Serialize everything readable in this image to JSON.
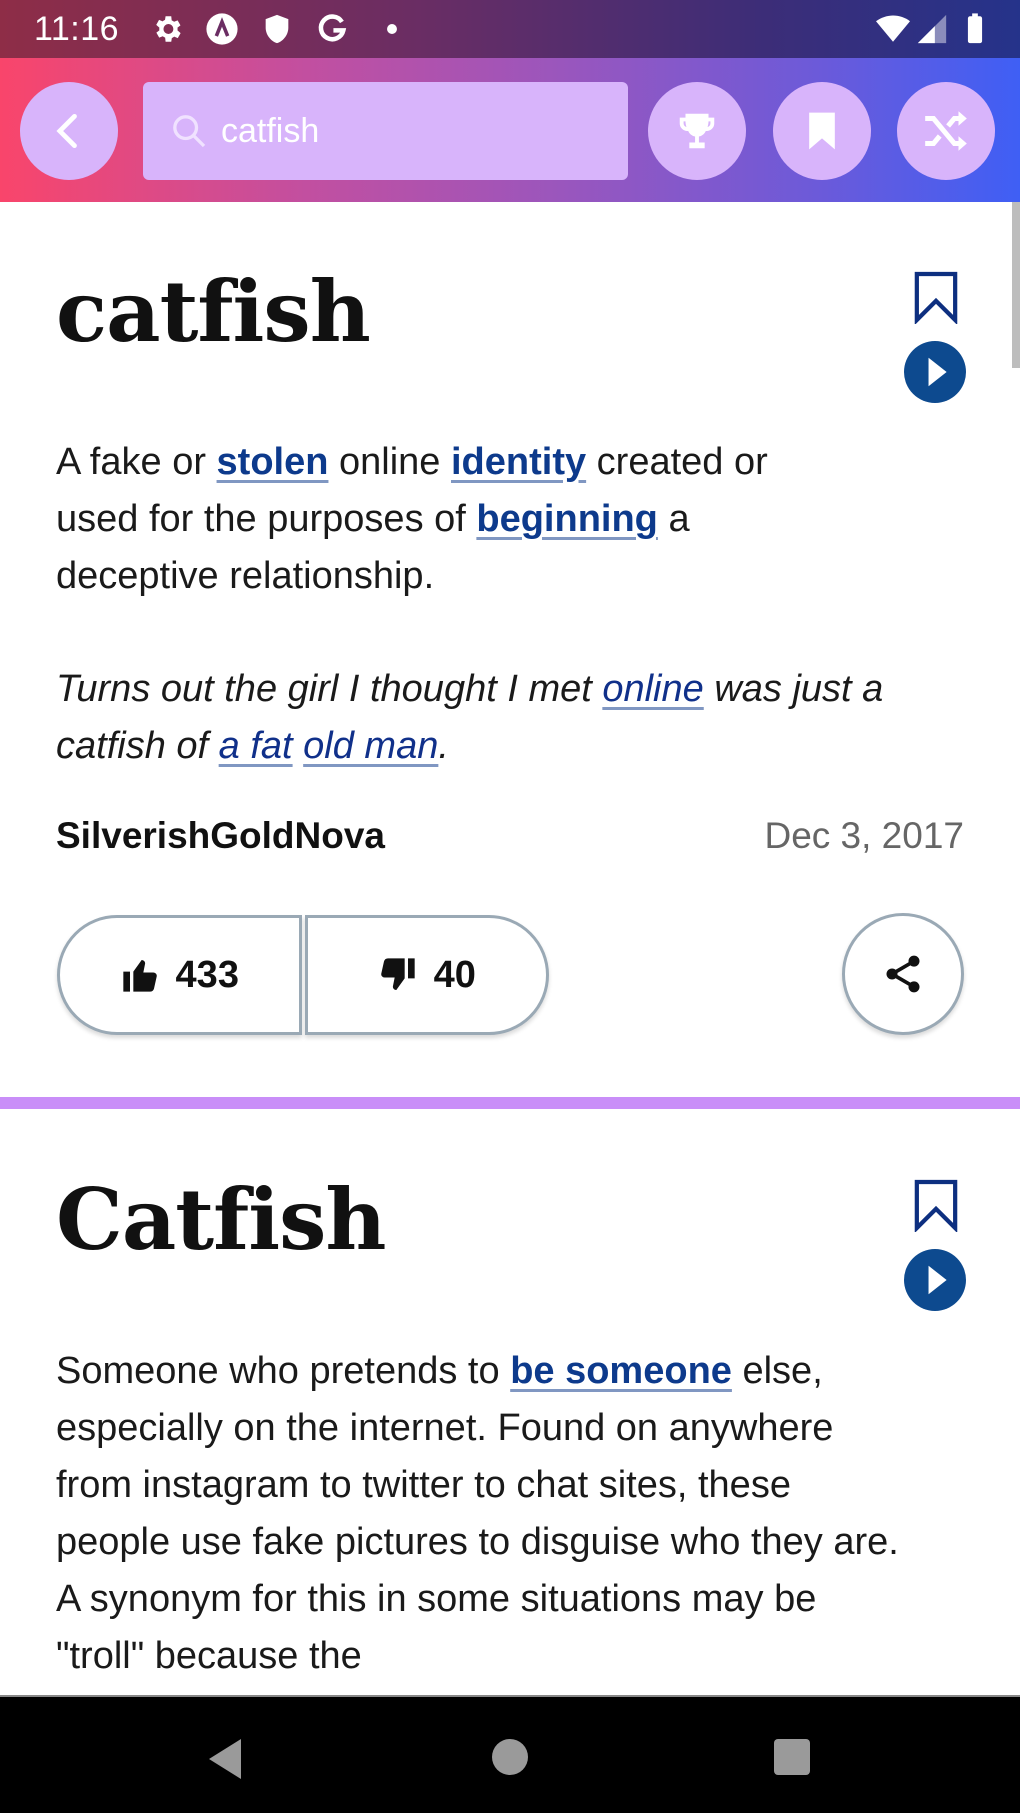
{
  "status_bar": {
    "time": "11:16",
    "left_icons": [
      "settings-icon",
      "app-a-icon",
      "shield-icon",
      "google-icon",
      "dot-icon"
    ],
    "right_icons": [
      "wifi-icon",
      "signal-icon",
      "battery-icon"
    ]
  },
  "header": {
    "back_icon": "chevron-left-icon",
    "search": {
      "value": "catfish",
      "icon": "search-icon"
    },
    "actions": [
      {
        "name": "trophy",
        "icon": "trophy-icon"
      },
      {
        "name": "saved",
        "icon": "bookmark-icon"
      },
      {
        "name": "random",
        "icon": "shuffle-icon"
      }
    ]
  },
  "colors": {
    "accent_link": "#0d3a8c",
    "button_bg": "#d8b4fb",
    "divider": "#c98ef8",
    "play": "#0d4a8f"
  },
  "entries": [
    {
      "word": "catfish",
      "definition": [
        {
          "t": "A fake or "
        },
        {
          "t": "stolen",
          "link": true
        },
        {
          "t": " online "
        },
        {
          "t": "identity",
          "link": true
        },
        {
          "t": " created or used for the purposes of "
        },
        {
          "t": "beginning",
          "link": true
        },
        {
          "t": " a deceptive relationship."
        }
      ],
      "example": [
        {
          "t": "Turns out the girl I thought I met "
        },
        {
          "t": "online",
          "link": true
        },
        {
          "t": " was just a catfish of "
        },
        {
          "t": "a fat",
          "link": true
        },
        {
          "t": " "
        },
        {
          "t": "old man",
          "link": true
        },
        {
          "t": "."
        }
      ],
      "author": "SilverishGoldNova",
      "date": "Dec 3, 2017",
      "upvotes": "433",
      "downvotes": "40"
    },
    {
      "word": "Catfish",
      "definition": [
        {
          "t": "Someone who pretends to "
        },
        {
          "t": "be someone",
          "link": true
        },
        {
          "t": " else, especially on the internet. Found on anywhere from instagram to twitter to chat sites, these people use fake pictures to disguise who they are. A synonym for this in some situations may be \"troll\" because the"
        }
      ]
    }
  ],
  "nav_bar": [
    "back-icon",
    "home-icon",
    "recents-icon"
  ]
}
